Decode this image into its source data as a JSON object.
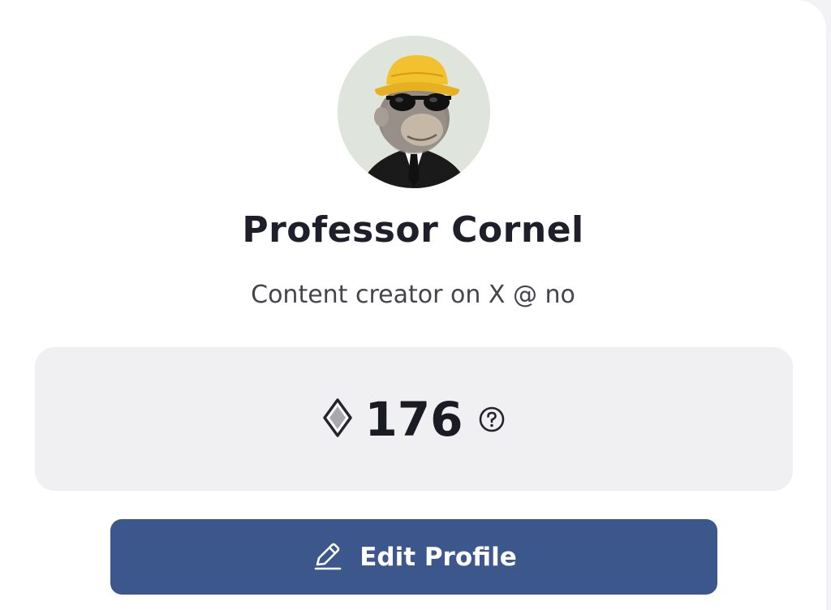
{
  "profile": {
    "name": "Professor Cornel",
    "bio": "Content creator on X @ no"
  },
  "points": {
    "value": "176",
    "icon": "diamond-icon",
    "help_icon": "question-circle-icon"
  },
  "actions": {
    "edit_label": "Edit Profile",
    "edit_icon": "pencil-icon"
  },
  "colors": {
    "accent": "#3b578c",
    "points_box": "#f0f0f3",
    "text_primary": "#1f1f2b"
  }
}
